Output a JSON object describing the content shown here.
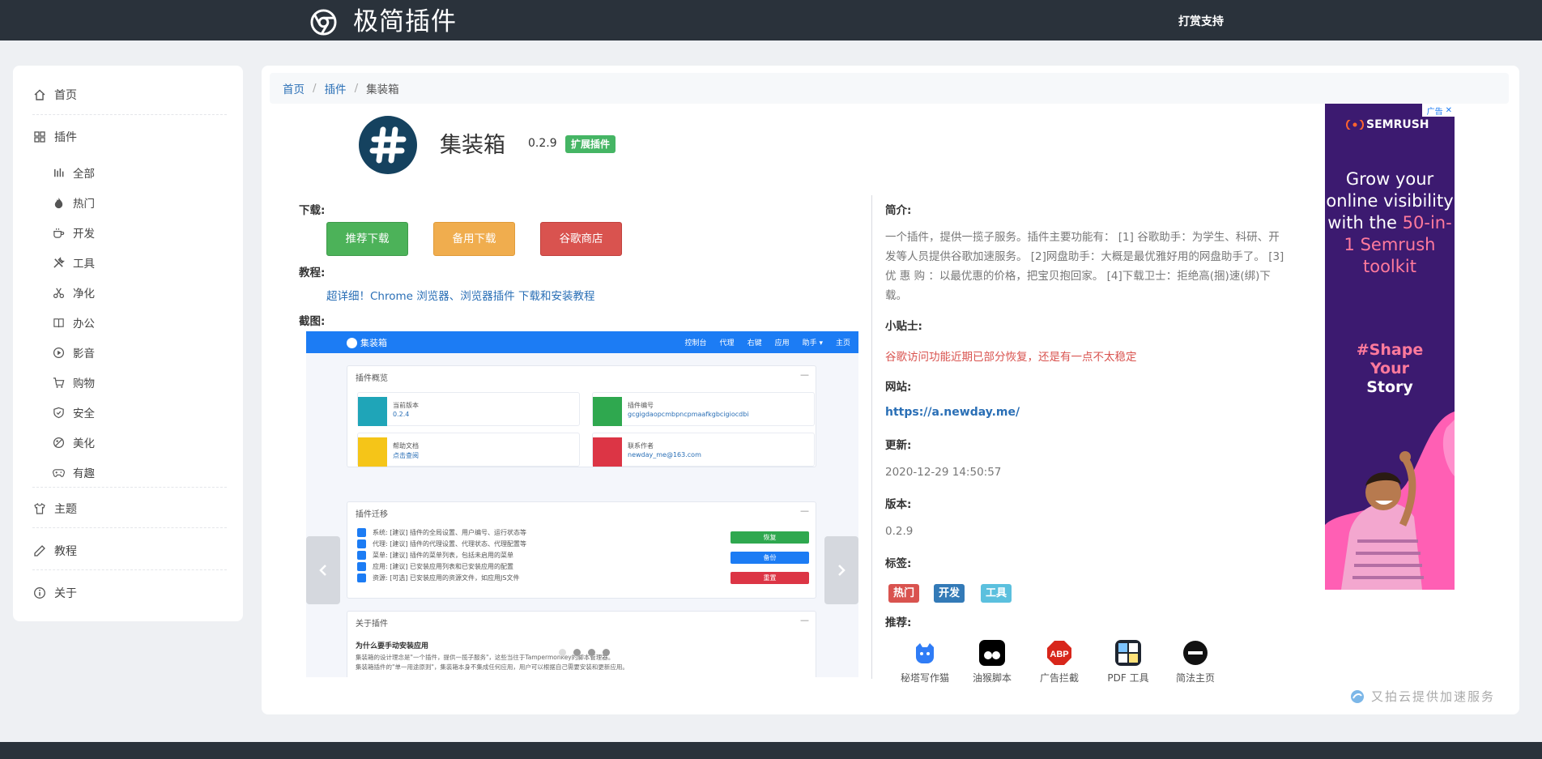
{
  "header": {
    "title": "极简插件",
    "support_link": "打赏支持"
  },
  "sidebar": {
    "home": "首页",
    "plugins": "插件",
    "sub_items": [
      "全部",
      "热门",
      "开发",
      "工具",
      "净化",
      "办公",
      "影音",
      "购物",
      "安全",
      "美化",
      "有趣"
    ],
    "themes": "主题",
    "tutorials": "教程",
    "about": "关于"
  },
  "breadcrumb": {
    "home": "首页",
    "plugins": "插件",
    "current": "集装箱"
  },
  "app": {
    "name": "集装箱",
    "version": "0.2.9",
    "badge": "扩展插件",
    "download_label": "下载:",
    "buttons": {
      "recommended": "推荐下载",
      "backup": "备用下载",
      "chrome_store": "谷歌商店"
    },
    "tutorial_label": "教程:",
    "tutorial_link": "超详细！Chrome 浏览器、浏览器插件 下载和安装教程",
    "screenshot_label": "截图:"
  },
  "screenshot": {
    "brand": "集装箱",
    "menu": [
      "控制台",
      "代理",
      "右键",
      "应用",
      "助手 ▾",
      "主页"
    ],
    "overview_title": "插件概览",
    "cards": [
      {
        "t1": "当前版本",
        "t2": "0.2.4"
      },
      {
        "t1": "插件编号",
        "t2": "gcgigdaopcmbpncpmaafkgbcigiocdbi"
      },
      {
        "t1": "帮助文档",
        "t2": "点击查阅"
      },
      {
        "t1": "联系作者",
        "t2": "newday_me@163.com"
      }
    ],
    "migrate_title": "插件迁移",
    "rows": [
      "系统: [建议] 插件的全局设置、用户编号、运行状态等",
      "代理: [建议] 插件的代理设置、代理状态、代理配置等",
      "菜单: [建议] 插件的菜单列表，包括未启用的菜单",
      "应用: [建议] 已安装应用列表和已安装应用的配置",
      "资源: [可选] 已安装应用的资源文件，如应用JS文件"
    ],
    "migrate_buttons": [
      "恢复",
      "备份",
      "重置"
    ],
    "about_title": "关于插件",
    "about_heading": "为什么要手动安装应用",
    "about_text1": "集装箱的设计理念是\"一个插件，提供一揽子服务\"，这些当往于Tampermonkey的脚本管理器。",
    "about_text2": "集装箱插件的\"单一用途原则\"，集装箱本身不集成任何应用，用户可以根据自己需要安装和更新应用。"
  },
  "info": {
    "intro_label": "简介:",
    "intro": "一个插件，提供一揽子服务。插件主要功能有： [1] 谷歌助手：为学生、科研、开发等人员提供谷歌加速服务。 [2]网盘助手：大概是最优雅好用的网盘助手了。 [3]优 惠 购 ：以最优惠的价格，把宝贝抱回家。 [4]下载卫士：拒绝高(捆)速(绑)下载。",
    "tip_label": "小贴士:",
    "tip": "谷歌访问功能近期已部分恢复，还是有一点不太稳定",
    "site_label": "网站:",
    "site": "https://a.newday.me/",
    "updated_label": "更新:",
    "updated": "2020-12-29 14:50:57",
    "version_label": "版本:",
    "version": "0.2.9",
    "tags_label": "标签:",
    "tags": [
      "热门",
      "开发",
      "工具"
    ],
    "recommend_label": "推荐:",
    "recommend": [
      "秘塔写作猫",
      "油猴脚本",
      "广告拦截",
      "PDF 工具",
      "简法主页"
    ]
  },
  "ad": {
    "close_label": "广告",
    "brand": "SEMRUSH",
    "headline_a": "Grow your online visibility with the",
    "headline_b": "50-in-1 Semrush toolkit",
    "sub_a": "#Shape",
    "sub_b": "Your",
    "sub_c": "Story"
  },
  "footer": {
    "cdn_text": "又拍云提供加速服务"
  },
  "colors": {
    "topbar": "#2a323b",
    "link": "#2a6fb6",
    "green": "#4cb259",
    "orange": "#f0ad4e",
    "red": "#d9534f"
  }
}
